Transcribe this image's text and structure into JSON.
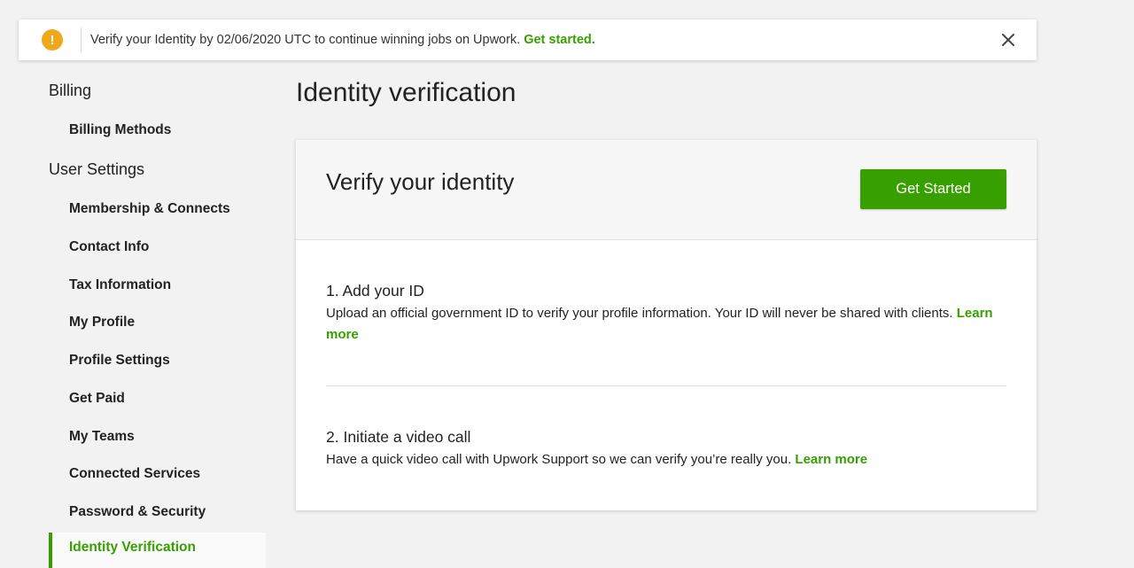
{
  "banner": {
    "icon": "warning-icon",
    "text": "Verify your Identity by 02/06/2020 UTC to continue winning jobs on Upwork.",
    "link": "Get started.",
    "close_icon": "close-icon"
  },
  "sidebar": {
    "billing_heading": "Billing",
    "billing_items": [
      "Billing Methods"
    ],
    "user_settings_heading": "User Settings",
    "user_items": [
      "Membership & Connects",
      "Contact Info",
      "Tax Information",
      "My Profile",
      "Profile Settings",
      "Get Paid",
      "My Teams",
      "Connected Services",
      "Password & Security"
    ],
    "active_item": "Identity Verification"
  },
  "main": {
    "page_title": "Identity verification",
    "card": {
      "title": "Verify your identity",
      "button": "Get Started",
      "steps": [
        {
          "title": "1. Add your ID",
          "description": "Upload an official government ID to verify your profile information. Your ID will never be shared with clients.",
          "link": "Learn more"
        },
        {
          "title": "2. Initiate a video call",
          "description": "Have a quick video call with Upwork Support so we can verify you’re really you.",
          "link": "Learn more"
        }
      ]
    }
  },
  "colors": {
    "accent": "#37a000",
    "warning": "#f0a81b",
    "background": "#f2f2f2"
  }
}
